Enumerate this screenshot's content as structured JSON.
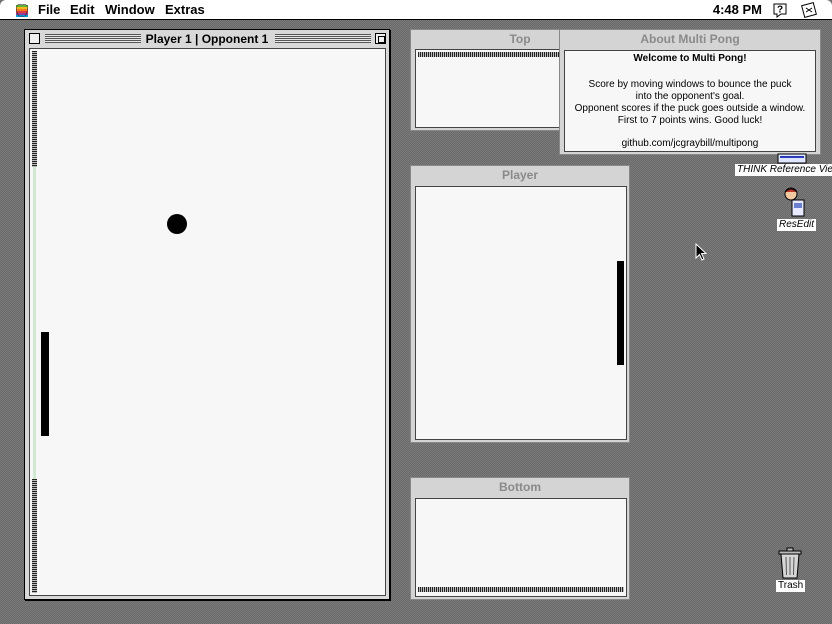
{
  "menubar": {
    "items": [
      "File",
      "Edit",
      "Window",
      "Extras"
    ],
    "clock": "4:48 PM"
  },
  "main_window": {
    "title": "Player 1 | Opponent 1"
  },
  "top_window": {
    "title": "Top"
  },
  "about_window": {
    "title": "About Multi Pong",
    "heading": "Welcome to Multi Pong!",
    "lines": [
      "Score by moving windows to bounce the puck",
      "into the opponent's goal.",
      "Opponent scores if the puck goes outside a window.",
      "First to 7 points wins. Good luck!"
    ],
    "link": "github.com/jcgraybill/multipong"
  },
  "player_window": {
    "title": "Player"
  },
  "bottom_window": {
    "title": "Bottom"
  },
  "desktop": {
    "icons": [
      {
        "label": "THINK Reference Vie",
        "icon": "think-reference-icon"
      },
      {
        "label": "ResEdit",
        "icon": "resedit-icon"
      },
      {
        "label": "Trash",
        "icon": "trash-icon"
      }
    ]
  },
  "colors": {
    "desktop": "#7a7a7a",
    "window_bg": "#f7f7f7",
    "paddle": "#000000"
  }
}
